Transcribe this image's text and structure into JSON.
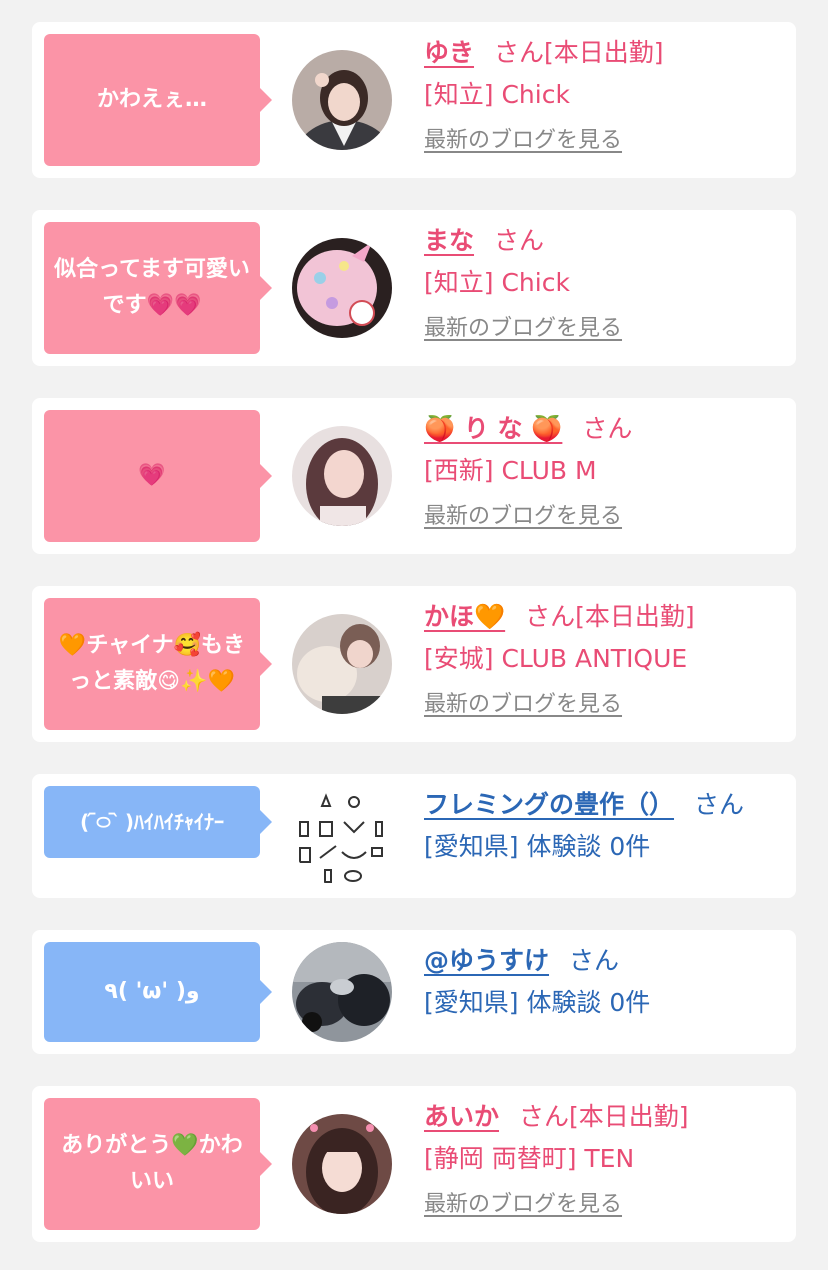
{
  "colors": {
    "pink_bubble": "#fb94a7",
    "blue_bubble": "#87b6f7",
    "pink_text": "#e94c75",
    "blue_text": "#2b67b5",
    "background": "#f2f2f2"
  },
  "comments": [
    {
      "message": "かわえぇ…",
      "bubble_color": "pink",
      "name": "ゆき",
      "honorific": "さん",
      "status": "[本日出勤]",
      "shop": "[知立] Chick",
      "blog_link": "最新のブログを見る",
      "text_color": "pink",
      "avatar": "girl-avatar"
    },
    {
      "message": "似合ってます可愛いです💗💗",
      "bubble_color": "pink",
      "name": "まな",
      "honorific": "さん",
      "status": "",
      "shop": "[知立] Chick",
      "blog_link": "最新のブログを見る",
      "text_color": "pink",
      "avatar": "plush-avatar"
    },
    {
      "message": "💗",
      "bubble_color": "pink",
      "name": "🍑 り な 🍑",
      "honorific": "さん",
      "status": "",
      "shop": "[西新] CLUB M",
      "blog_link": "最新のブログを見る",
      "text_color": "pink",
      "avatar": "girl-avatar"
    },
    {
      "message": "🧡チャイナ🥰もきっと素敵😋✨🧡",
      "bubble_color": "pink",
      "name": "かほ🧡",
      "honorific": "さん",
      "status": "[本日出勤]",
      "shop": "[安城] CLUB ANTIQUE",
      "blog_link": "最新のブログを見る",
      "text_color": "pink",
      "avatar": "blanket-avatar"
    },
    {
      "message": "( ᷇࿀ ᷆ )ﾊｲﾊｲﾁｬｲﾅｰ",
      "bubble_color": "blue",
      "name": "フレミングの豊作（）",
      "honorific": "さん",
      "status": "",
      "shop": "[愛知県] 体験談 0件",
      "blog_link": "",
      "text_color": "blue",
      "avatar": "tools-avatar"
    },
    {
      "message": "٩( 'ω' )و",
      "bubble_color": "blue",
      "name": "@ゆうすけ",
      "honorific": "さん",
      "status": "",
      "shop": "[愛知県] 体験談 0件",
      "blog_link": "",
      "text_color": "blue",
      "avatar": "motorcycle-avatar"
    },
    {
      "message": "ありがとう💚かわいい",
      "bubble_color": "pink",
      "name": "あいか",
      "honorific": "さん",
      "status": "[本日出勤]",
      "shop": "[静岡 両替町] TEN",
      "blog_link": "最新のブログを見る",
      "text_color": "pink",
      "avatar": "girl-avatar"
    }
  ]
}
